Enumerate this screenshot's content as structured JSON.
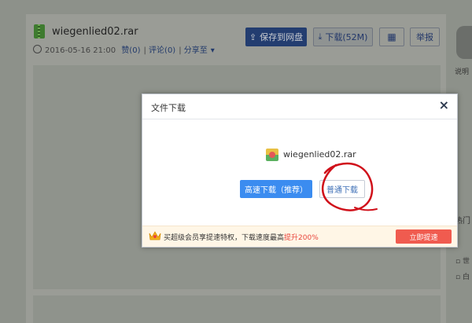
{
  "background": {
    "file_name": "wiegenlied02.rar",
    "date": "2016-05-16 21:00",
    "like_label": "赞(0)",
    "comment_label": "评论(0)",
    "share_label": "分享至",
    "save_button": "保存到网盘",
    "download_button": "下载(52M)",
    "report_button": "举报",
    "side_label": "说明",
    "side_hot": "热门",
    "side_item1": "世",
    "side_item2": "白"
  },
  "dialog": {
    "title": "文件下载",
    "close_icon": "×",
    "file_name": "wiegenlied02.rar",
    "fast_button": "高速下载（推荐）",
    "normal_button": "普通下载",
    "promo_text": "买超级会员享提速特权，下载速度最高",
    "promo_highlight": "提升200%",
    "speed_button": "立即提速"
  },
  "colors": {
    "primary": "#3b8cf0",
    "promo_button": "#f05b4f",
    "highlight": "#e8443a",
    "annotation": "#d0101a"
  }
}
